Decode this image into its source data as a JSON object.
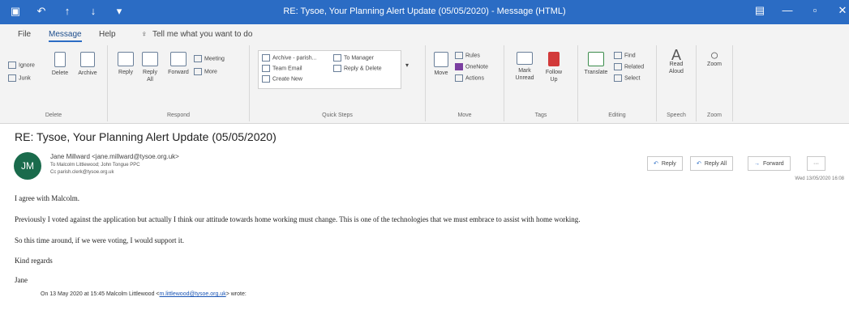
{
  "titlebar": {
    "title": "RE: Tysoe, Your Planning Alert Update (05/05/2020)  -  Message (HTML)",
    "quick_access": [
      "save-icon",
      "undo-icon",
      "up-arrow-icon",
      "down-arrow-icon",
      "customize-icon"
    ]
  },
  "tabs": {
    "file": "File",
    "message": "Message",
    "help": "Help",
    "tell_me": "Tell me what you want to do"
  },
  "ribbon": {
    "delete_group": {
      "label": "Delete",
      "ignore": "Ignore",
      "junk": "Junk",
      "delete": "Delete",
      "archive": "Archive"
    },
    "respond_group": {
      "label": "Respond",
      "reply": "Reply",
      "reply_all": "Reply All",
      "forward": "Forward",
      "meeting": "Meeting",
      "more": "More"
    },
    "quick_steps": {
      "label": "Quick Steps",
      "items": [
        "Archive - parish...",
        "Team Email",
        "Create New",
        "To Manager",
        "Reply & Delete"
      ]
    },
    "move_group": {
      "label": "Move",
      "move": "Move",
      "rules": "Rules",
      "onenote": "OneNote",
      "actions": "Actions"
    },
    "tags_group": {
      "label": "Tags",
      "unread": "Mark Unread",
      "follow_up": "Follow Up"
    },
    "editing_group": {
      "label": "Editing",
      "translate": "Translate",
      "find": "Find",
      "related": "Related",
      "select": "Select"
    },
    "speech_group": {
      "label": "Speech",
      "read_aloud": "Read Aloud"
    },
    "zoom_group": {
      "label": "Zoom",
      "zoom": "Zoom"
    }
  },
  "message": {
    "subject": "RE: Tysoe, Your Planning Alert Update (05/05/2020)",
    "avatar_initials": "JM",
    "from": "Jane Millward <jane.millward@tysoe.org.uk>",
    "to": "To   Malcolm Littlewood; John Tongue PPC",
    "cc": "Cc   parish.clerk@tysoe.org.uk",
    "date": "Wed 13/05/2020 16:08",
    "actions": {
      "reply": "Reply",
      "reply_all": "Reply All",
      "forward": "Forward",
      "more": "···"
    },
    "body": [
      "I agree with Malcolm.",
      "Previously I voted against the application but actually I think our attitude towards home working must change.  This is one of the technologies that we must embrace to assist with home working.",
      "So this time around, if we were voting, I would support it.",
      "Kind regards",
      "Jane"
    ],
    "quote_prefix": "On 13 May 2020 at 15:45 Malcolm Littlewood <",
    "quote_email": "m.littlewood@tysoe.org.uk",
    "quote_suffix": "> wrote:"
  }
}
